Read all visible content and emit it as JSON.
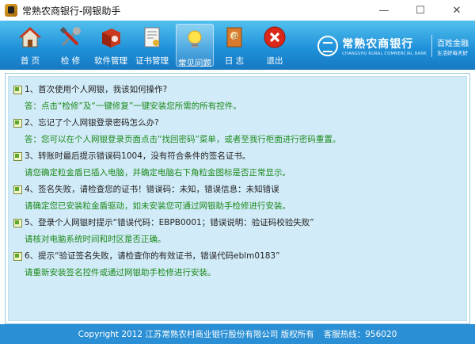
{
  "window": {
    "title": "常熟农商银行-网银助手",
    "controls": [
      "—",
      "☐",
      "✕"
    ]
  },
  "toolbar": {
    "buttons": [
      {
        "label": "首 页",
        "icon": "home-icon"
      },
      {
        "label": "检 修",
        "icon": "tools-icon"
      },
      {
        "label": "软件管理",
        "icon": "software-box-icon"
      },
      {
        "label": "证书管理",
        "icon": "certificate-icon"
      },
      {
        "label": "常见问题",
        "icon": "lightbulb-icon",
        "active": true
      },
      {
        "label": "日 志",
        "icon": "log-book-icon"
      },
      {
        "label": "退出",
        "icon": "exit-icon"
      }
    ]
  },
  "brand": {
    "name": "常熟农商银行",
    "english": "CHANGSHU RURAL COMMERCIAL BANK",
    "slogan": "百姓金融",
    "slogan_sub": "生活好每天好",
    "color": "#ffffff"
  },
  "faq": [
    {
      "q": "1、首次使用个人网银，我该如何操作?",
      "a": "答：点击“检修”及“一键修复”一键安装您所需的所有控件。"
    },
    {
      "q": "2、忘记了个人网银登录密码怎么办?",
      "a": "答：您可以在个人网银登录页面点击“找回密码”菜单，或者至我行柜面进行密码重置。"
    },
    {
      "q": "3、转账时最后提示错误码1004，没有符合条件的签名证书。",
      "a": "请您确定粒金盾已插入电脑，并确定电脑右下角粒金图标是否正常显示。"
    },
    {
      "q": "4、签名失败，请检查您的证书！错误码：未知，错误信息：未知错误",
      "a": "请确定您已安装粒金盾驱动，如未安装您可通过网银助手检修进行安装。"
    },
    {
      "q": "5、登录个人网银时提示“错误代码：EBPB0001；错误说明：验证码校验失败”",
      "a": "请核对电脑系统时间和时区是否正确。"
    },
    {
      "q": "6、提示“验证签名失败，请检查你的有效证书，错误代码eblm0183”",
      "a": "请重新安装签名控件或通过网银助手检修进行安装。"
    }
  ],
  "footer": {
    "copyright": "Copyright 2012 江苏常熟农村商业银行股份有限公司 版权所有",
    "hotline": "客服热线：956020"
  },
  "colors": {
    "toolbar_top": "#52c0ee",
    "toolbar_bottom": "#1779c2",
    "content_bg": "#d2ebf8",
    "answer_text": "#1b8a1b",
    "footer_bg": "#2a8fd4"
  }
}
